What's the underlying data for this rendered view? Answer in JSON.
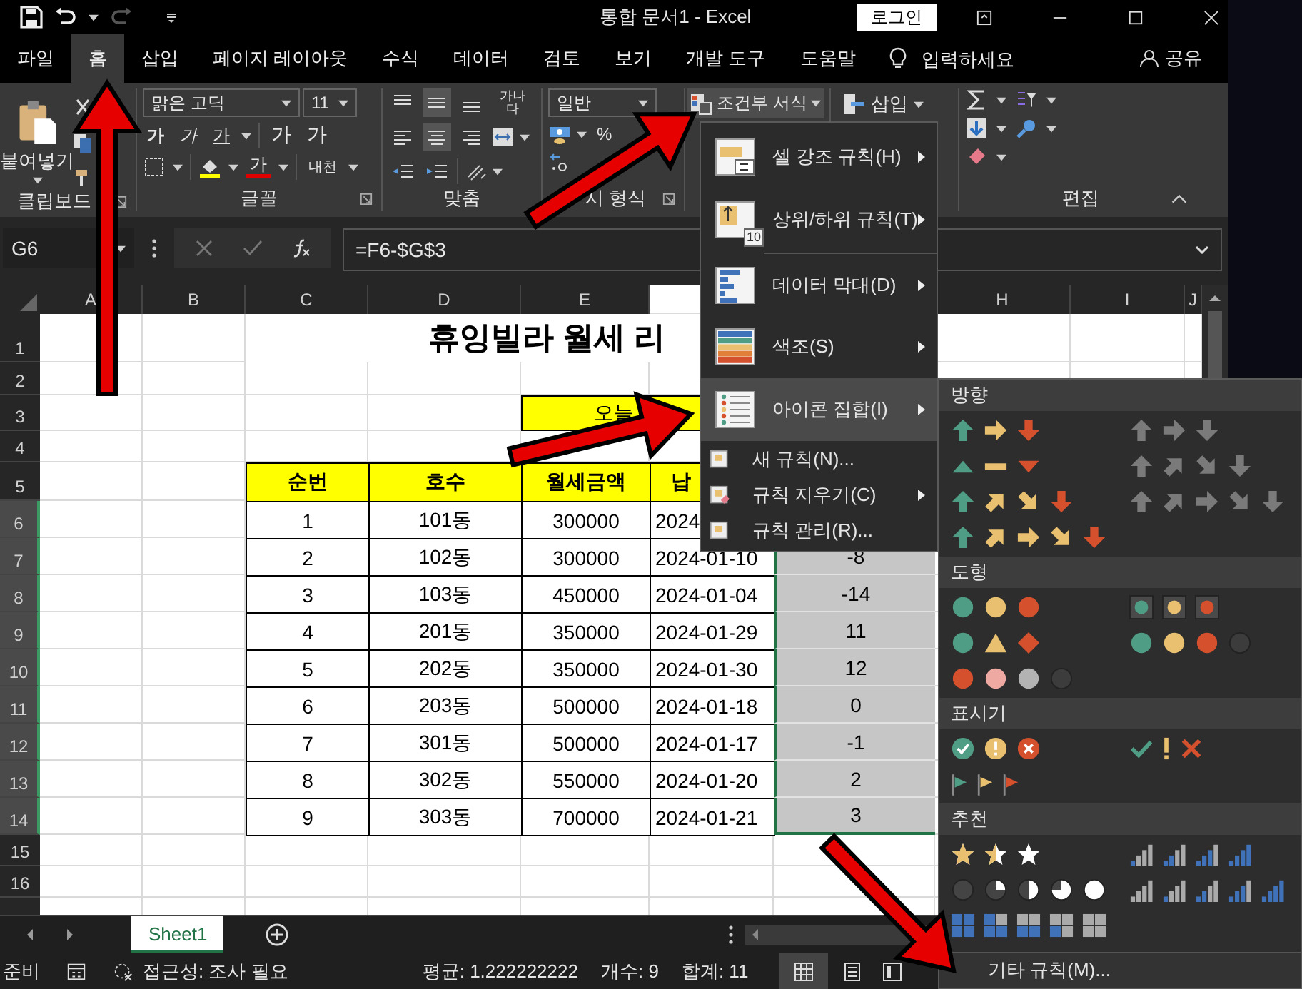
{
  "title_bar": {
    "document_title": "통합 문서1  -  Excel",
    "login_button": "로그인"
  },
  "tabs": [
    {
      "label": "파일",
      "selected": false
    },
    {
      "label": "홈",
      "selected": true
    },
    {
      "label": "삽입",
      "selected": false
    },
    {
      "label": "페이지 레이아웃",
      "selected": false
    },
    {
      "label": "수식",
      "selected": false
    },
    {
      "label": "데이터",
      "selected": false
    },
    {
      "label": "검토",
      "selected": false
    },
    {
      "label": "보기",
      "selected": false
    },
    {
      "label": "개발 도구",
      "selected": false
    },
    {
      "label": "도움말",
      "selected": false
    }
  ],
  "tell_me": {
    "placeholder": "입력하세요"
  },
  "share_button": "공유",
  "ribbon": {
    "clipboard": {
      "paste": "붙여넣기",
      "label": "클립보드"
    },
    "font": {
      "font_name": "맑은 고딕",
      "font_size": "11",
      "style_buttons": [
        "가",
        "가",
        "가"
      ],
      "size_buttons": [
        "가",
        "가"
      ],
      "font_color_button": "가",
      "phonetic_button": "내천",
      "label": "글꼴"
    },
    "alignment": {
      "wrap_text": [
        "가나",
        "다"
      ],
      "label": "맞춤"
    },
    "number": {
      "format": "일반",
      "percent_button": "%",
      "label": "시 형식"
    },
    "conditional_formatting_button": {
      "label": "조건부 서식",
      "expanded": true
    },
    "cells": {
      "insert_button": "삽입"
    },
    "editing": {
      "label": "편집"
    }
  },
  "formula_bar": {
    "name_box": "G6",
    "formula": "=F6-$G$3"
  },
  "sheet": {
    "column_headers": [
      "A",
      "B",
      "C",
      "D",
      "E",
      "H",
      "I",
      "J"
    ],
    "row_headers": [
      "1",
      "2",
      "3",
      "4",
      "5",
      "6",
      "7",
      "8",
      "9",
      "10",
      "11",
      "12",
      "13",
      "14",
      "15",
      "16"
    ],
    "title": "휴잉빌라 월세 리",
    "today_label": "오늘",
    "table": {
      "columns": [
        "순번",
        "호수",
        "월세금액",
        "납"
      ],
      "rows": [
        {
          "cells": [
            "1",
            "101동",
            "300000",
            "2024"
          ]
        },
        {
          "cells": [
            "2",
            "102동",
            "300000",
            "2024-01-10"
          ],
          "difference": "-8"
        },
        {
          "cells": [
            "3",
            "103동",
            "450000",
            "2024-01-04"
          ],
          "difference": "-14"
        },
        {
          "cells": [
            "4",
            "201동",
            "350000",
            "2024-01-29"
          ],
          "difference": "11"
        },
        {
          "cells": [
            "5",
            "202동",
            "350000",
            "2024-01-30"
          ],
          "difference": "12"
        },
        {
          "cells": [
            "6",
            "203동",
            "500000",
            "2024-01-18"
          ],
          "difference": "0"
        },
        {
          "cells": [
            "7",
            "301동",
            "500000",
            "2024-01-17"
          ],
          "difference": "-1"
        },
        {
          "cells": [
            "8",
            "302동",
            "550000",
            "2024-01-20"
          ],
          "difference": "2"
        },
        {
          "cells": [
            "9",
            "303동",
            "700000",
            "2024-01-21"
          ],
          "difference": "3"
        }
      ]
    }
  },
  "sheet_tabs": [
    {
      "label": "Sheet1",
      "selected": true
    }
  ],
  "status_bar": {
    "mode": "준비",
    "accessibility": "접근성: 조사 필요",
    "average": "평균: 1.222222222",
    "count": "개수: 9",
    "sum": "합계: 11"
  },
  "conditional_formatting_menu": {
    "items": [
      {
        "label": "셀 강조 규칙(H)",
        "kind": "large",
        "submenu": true,
        "selected": false
      },
      {
        "label": "상위/하위 규칙(T)",
        "kind": "large",
        "badge": "10",
        "submenu": true,
        "selected": false
      },
      {
        "label": "데이터 막대(D)",
        "kind": "large",
        "submenu": true,
        "selected": false
      },
      {
        "label": "색조(S)",
        "kind": "large",
        "submenu": true,
        "selected": false
      },
      {
        "label": "아이콘 집합(I)",
        "kind": "large",
        "submenu": true,
        "selected": true
      },
      {
        "label": "새 규칙(N)...",
        "kind": "small",
        "submenu": false,
        "selected": false
      },
      {
        "label": "규칙 지우기(C)",
        "kind": "small",
        "submenu": true,
        "selected": false
      },
      {
        "label": "규칙 관리(R)...",
        "kind": "small",
        "submenu": false,
        "selected": false
      }
    ]
  },
  "icon_sets_menu": {
    "sections": [
      {
        "title": "방향",
        "kind": "directional"
      },
      {
        "title": "도형",
        "kind": "shapes"
      },
      {
        "title": "표시기",
        "kind": "indicators"
      },
      {
        "title": "추천",
        "kind": "ratings"
      }
    ],
    "more_rules": "기타 규칙(M)..."
  }
}
